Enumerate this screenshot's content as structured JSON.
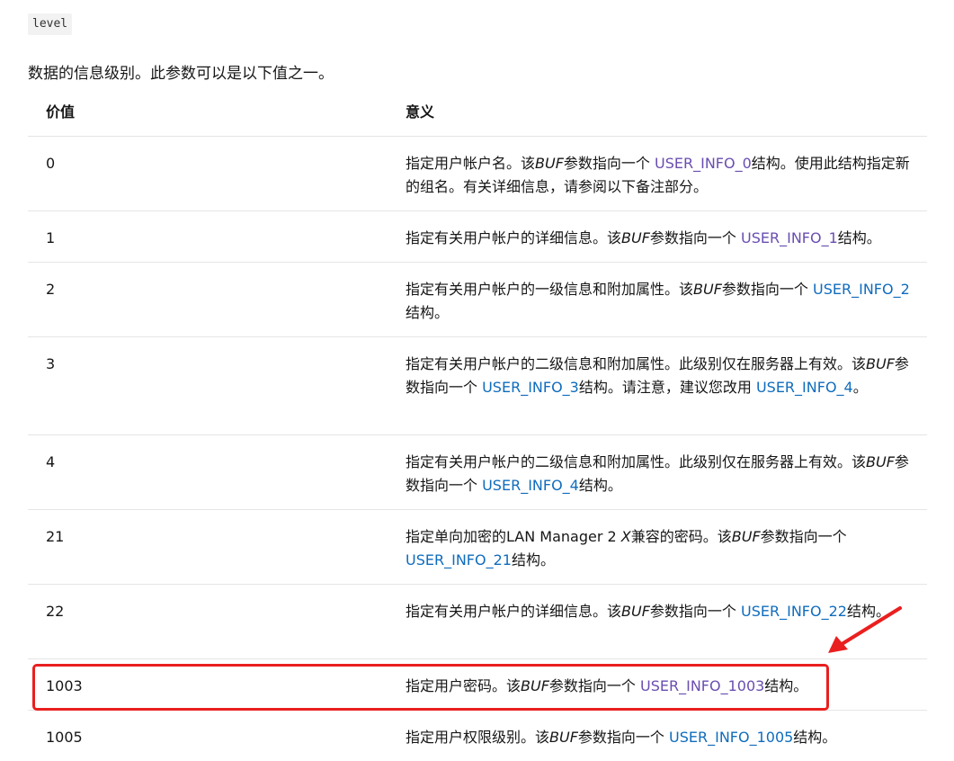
{
  "param": {
    "name": "level"
  },
  "intro": "数据的信息级别。此参数可以是以下值之一。",
  "table": {
    "headers": {
      "value": "价值",
      "meaning": "意义"
    },
    "rows": [
      {
        "value": "0",
        "m1": "指定用户帐户名。该",
        "italic": "BUF",
        "m2": "参数指向一个 ",
        "link": "USER_INFO_0",
        "m3": "结构。使用此结构指定新的组名。有关详细信息，请参阅以下备注部分。"
      },
      {
        "value": "1",
        "m1": "指定有关用户帐户的详细信息。该",
        "italic": "BUF",
        "m2": "参数指向一个 ",
        "link": "USER_INFO_1",
        "m3": "结构。"
      },
      {
        "value": "2",
        "m1": "指定有关用户帐户的一级信息和附加属性。该",
        "italic": "BUF",
        "m2": "参数指向一个 ",
        "link": "USER_INFO_2",
        "m3": "结构。"
      },
      {
        "value": "3",
        "m1": "指定有关用户帐户的二级信息和附加属性。此级别仅在服务器上有效。该",
        "italic": "BUF",
        "m2": "参数指向一个 ",
        "link": "USER_INFO_3",
        "m3": "结构。请注意，建议您改用 ",
        "link2": "USER_INFO_4",
        "m4": "。"
      },
      {
        "value": "4",
        "m1": "指定有关用户帐户的二级信息和附加属性。此级别仅在服务器上有效。该",
        "italic": "BUF",
        "m2": "参数指向一个 ",
        "link": "USER_INFO_4",
        "m3": "结构。"
      },
      {
        "value": "21",
        "m1": "指定单向加密的LAN Manager 2 ",
        "italic_x": "X",
        "m1b": "兼容的密码。该",
        "italic": "BUF",
        "m2": "参数指向一个 ",
        "link": "USER_INFO_21",
        "m3": "结构。"
      },
      {
        "value": "22",
        "m1": "指定有关用户帐户的详细信息。该",
        "italic": "BUF",
        "m2": "参数指向一个 ",
        "link": "USER_INFO_22",
        "m3": "结构。"
      },
      {
        "value": "1003",
        "m1": "指定用户密码。该",
        "italic": "BUF",
        "m2": "参数指向一个 ",
        "link": "USER_INFO_1003",
        "m3": "结构。"
      },
      {
        "value": "1005",
        "m1": "指定用户权限级别。该",
        "italic": "BUF",
        "m2": "参数指向一个 ",
        "link": "USER_INFO_1005",
        "m3": "结构。"
      }
    ]
  },
  "colors": {
    "link": "#0f6cbd",
    "visited_link": "#6a4eb0",
    "highlight": "#ea1f1f",
    "divider": "#e5e5e5"
  }
}
